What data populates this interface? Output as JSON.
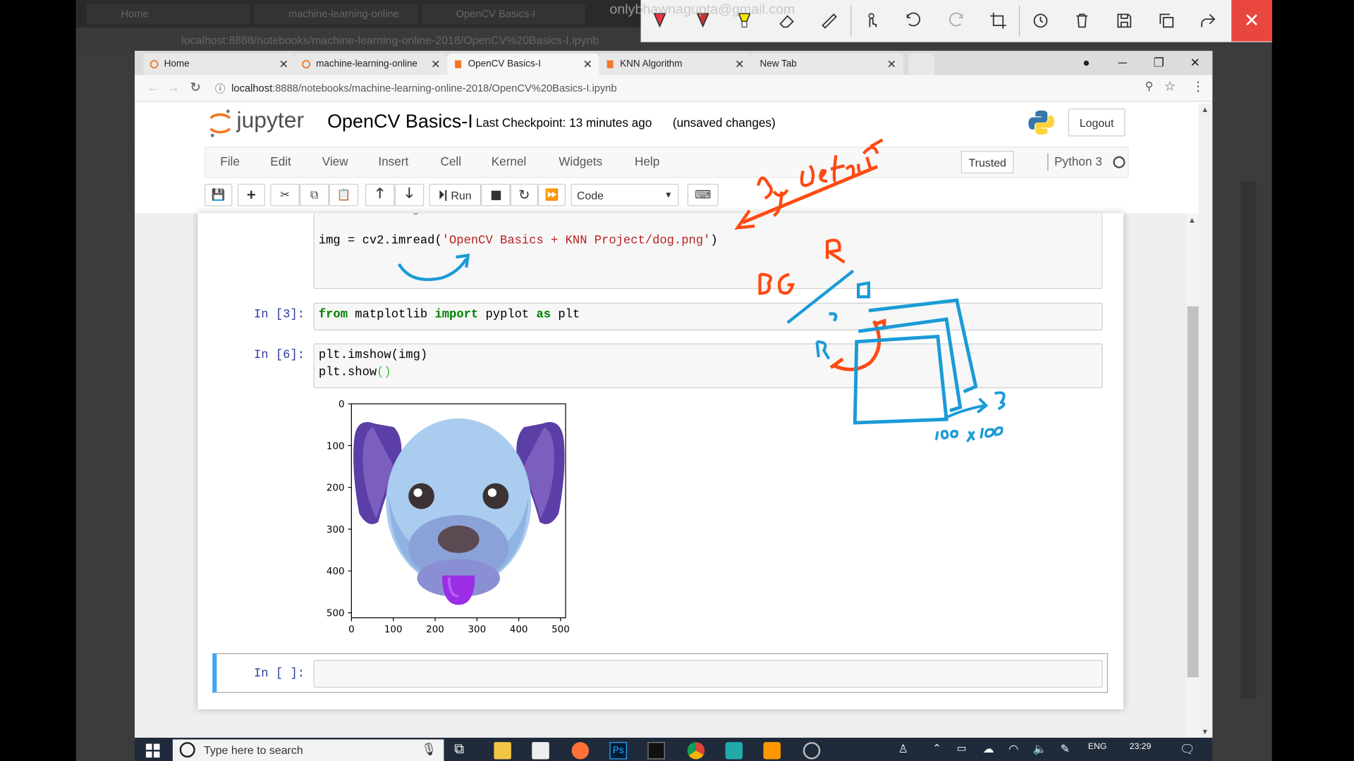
{
  "annotation_toolbar": {
    "overlay_text": "onlybhawnagupta@gmail.com",
    "accent": "#e8463f",
    "tools": [
      "pen-icon",
      "pen-icon",
      "highlighter-icon",
      "eraser-icon",
      "ruler-icon",
      "touch-write-icon",
      "undo-icon",
      "redo-icon",
      "crop-icon",
      "history-icon",
      "delete-icon",
      "save-icon",
      "copy-icon",
      "share-icon"
    ],
    "close_label": "✕"
  },
  "background_browser": {
    "tabs": [
      "Home",
      "machine-learning-online",
      "OpenCV Basics-I"
    ],
    "url": "localhost:8888/notebooks/machine-learning-online-2018/OpenCV%20Basics-I.ipynb"
  },
  "browser": {
    "tabs": [
      {
        "label": "Home",
        "active": false
      },
      {
        "label": "machine-learning-online",
        "active": false
      },
      {
        "label": "OpenCV Basics-I",
        "active": true
      },
      {
        "label": "KNN Algorithm",
        "active": false
      },
      {
        "label": "New Tab",
        "active": false
      }
    ],
    "url_host": "localhost",
    "url_path": ":8888/notebooks/machine-learning-online-2018/OpenCV%20Basics-I.ipynb"
  },
  "jupyter": {
    "logo_text": "jupyter",
    "notebook_name": "OpenCV Basics-I",
    "checkpoint": "Last Checkpoint: 13 minutes ago",
    "unsaved": "(unsaved changes)",
    "logout": "Logout",
    "menu": [
      "File",
      "Edit",
      "View",
      "Insert",
      "Cell",
      "Kernel",
      "Widgets",
      "Help"
    ],
    "trusted": "Trusted",
    "kernel": "Python 3",
    "toolbar": {
      "run_label": "Run",
      "cell_type": "Code"
    }
  },
  "cells": {
    "c1_comment": "# Read an image",
    "c1_code_pre": "img = cv2.imread(",
    "c1_code_str": "'OpenCV Basics + KNN Project/dog.png'",
    "c1_code_post": ")",
    "c2_prompt": "In [3]:",
    "c2_from": "from",
    "c2_mod": " matplotlib ",
    "c2_import": "import",
    "c2_name": " pyplot ",
    "c2_as": "as",
    "c2_alias": " plt",
    "c3_prompt": "In [6]:",
    "c3_line1": "plt.imshow(img)",
    "c3_line2_pre": "plt.show",
    "c3_line2_paren": "()",
    "c4_prompt": "In [ ]:"
  },
  "output_plot": {
    "y_ticks": [
      "0",
      "100",
      "200",
      "300",
      "400",
      "500"
    ],
    "x_ticks": [
      "0",
      "100",
      "200",
      "300",
      "400",
      "500"
    ]
  },
  "chart_data": {
    "type": "image",
    "title": "",
    "xlabel": "",
    "ylabel": "",
    "xlim": [
      0,
      512
    ],
    "ylim": [
      512,
      0
    ],
    "x_ticks": [
      0,
      100,
      200,
      300,
      400,
      500
    ],
    "y_ticks": [
      0,
      100,
      200,
      300,
      400,
      500
    ],
    "grid": false
  },
  "ink": {
    "by_default": "By default",
    "bgr": "B G R",
    "b_label": "B",
    "r_label": "R",
    "g_label": "G",
    "dims": "100 x 100",
    "three": "3",
    "orange": "#ff4a12",
    "blue": "#1a9bd7"
  },
  "taskbar": {
    "search_placeholder": "Type here to search",
    "lang": "ENG",
    "time": "23:29"
  }
}
